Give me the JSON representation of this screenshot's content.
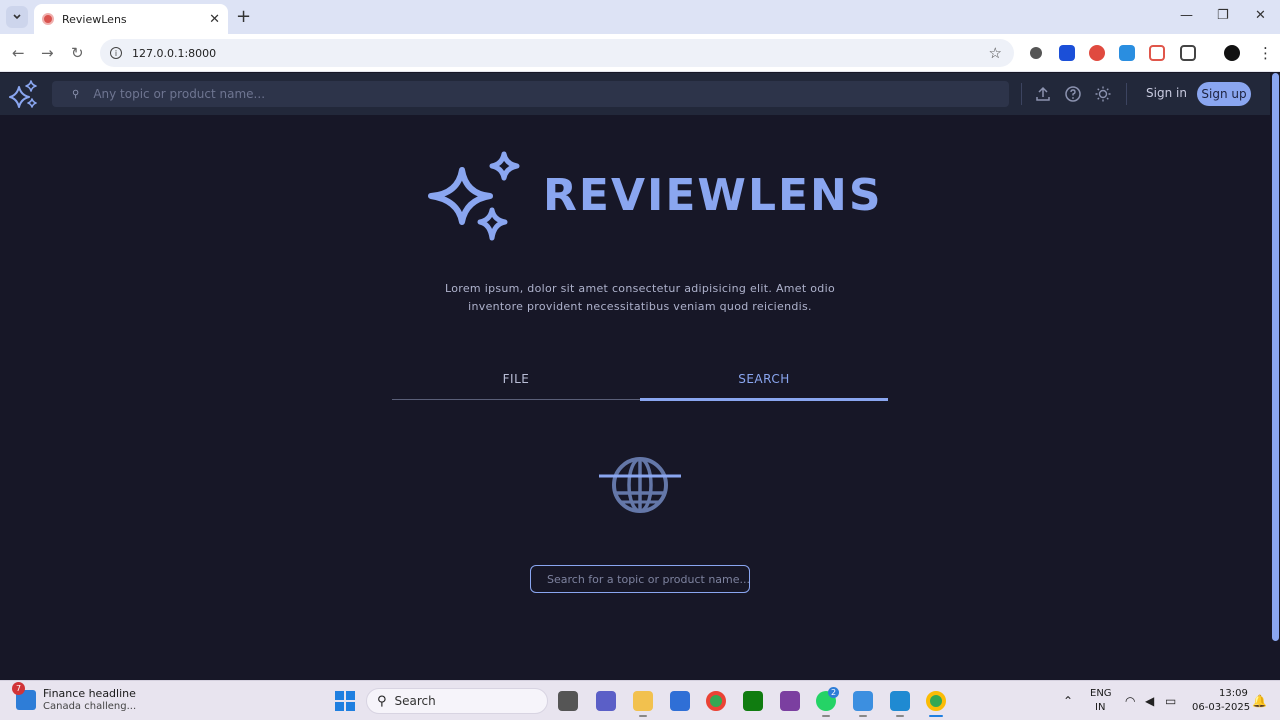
{
  "browser": {
    "tab_title": "ReviewLens",
    "url": "127.0.0.1:8000"
  },
  "header": {
    "search_placeholder": "Any topic or product name...",
    "signin_label": "Sign in",
    "signup_label": "Sign up"
  },
  "hero": {
    "brand": "REVIEWLENS",
    "description": "Lorem ipsum, dolor sit amet consectetur adipisicing elit. Amet odio inventore provident necessitatibus veniam quod reiciendis."
  },
  "tabs": [
    {
      "label": "FILE",
      "active": false
    },
    {
      "label": "SEARCH",
      "active": true
    }
  ],
  "main_search": {
    "placeholder": "Search for a topic or product name..."
  },
  "taskbar": {
    "news_title": "Finance headline",
    "news_subtitle": "Canada challeng...",
    "news_badge": "7",
    "search_label": "Search",
    "whatsapp_badge": "2",
    "language_top": "ENG",
    "language_bottom": "IN",
    "time": "13:09",
    "date": "06-03-2025"
  },
  "colors": {
    "accent": "#8aa6f0",
    "background": "#171727",
    "header": "#22283a"
  }
}
